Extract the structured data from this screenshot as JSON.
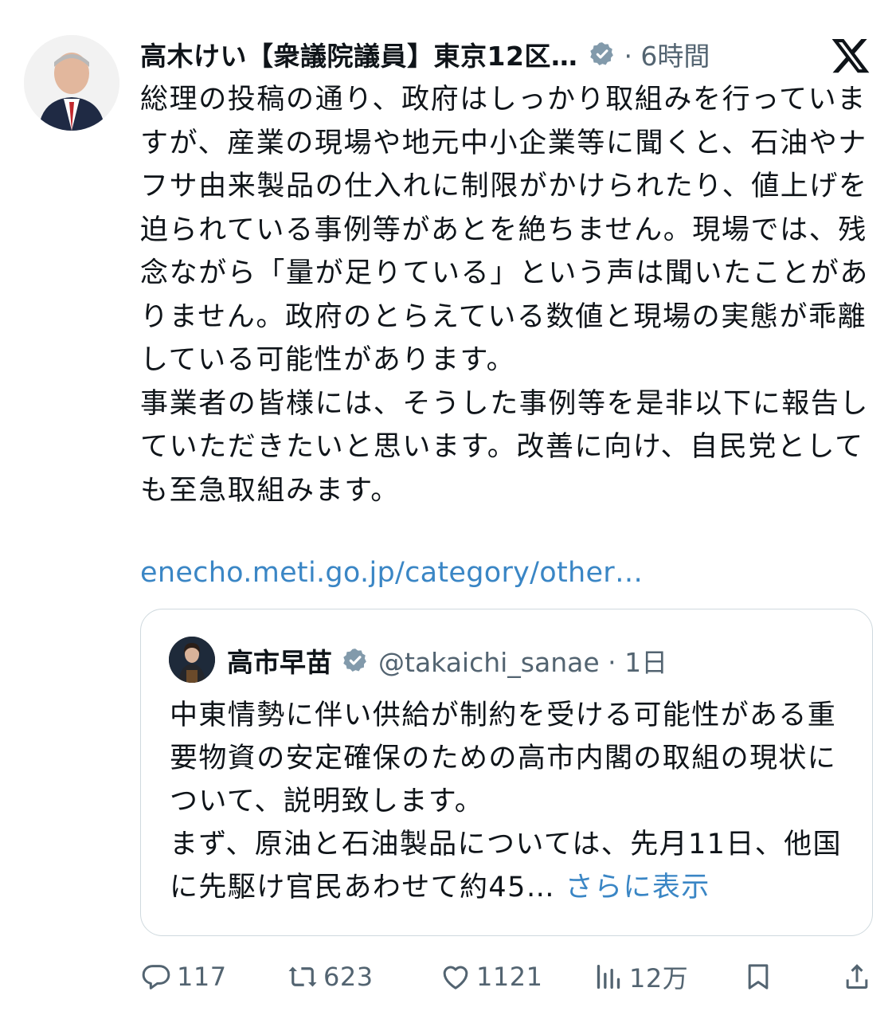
{
  "post": {
    "author_name": "高木けい【衆議院議員】東京12区…",
    "time": "· 6時間",
    "body": "総理の投稿の通り、政府はしっかり取組みを行っていますが、産業の現場や地元中小企業等に聞くと、石油やナフサ由来製品の仕入れに制限がかけられたり、値上げを迫られている事例等があとを絶ちません。現場では、残念ながら「量が足りている」という声は聞いたことがありません。政府のとらえている数値と現場の実態が乖離している可能性があります。\n事業者の皆様には、そうした事例等を是非以下に報告していただきたいと思います。改善に向け、自民党としても至急取組みます。",
    "link": "enecho.meti.go.jp/category/other…"
  },
  "quoted": {
    "name": "高市早苗",
    "handle_time": "@takaichi_sanae · 1日",
    "text": "中東情勢に伴い供給が制約を受ける可能性がある重要物資の安定確保のための高市内閣の取組の現状について、説明致します。\nまず、原油と石油製品については、先月11日、他国に先駆け官民あわせて約45… ",
    "show_more": "さらに表示"
  },
  "actions": {
    "replies": "117",
    "reposts": "623",
    "likes": "1121",
    "views": "12万"
  },
  "colors": {
    "accent_link": "#3a86c5",
    "muted": "#536471",
    "border": "#cfd9de"
  },
  "icons": [
    "verified-badge-icon",
    "x-logo-icon",
    "reply-icon",
    "repost-icon",
    "like-icon",
    "views-icon",
    "bookmark-icon",
    "share-icon"
  ]
}
